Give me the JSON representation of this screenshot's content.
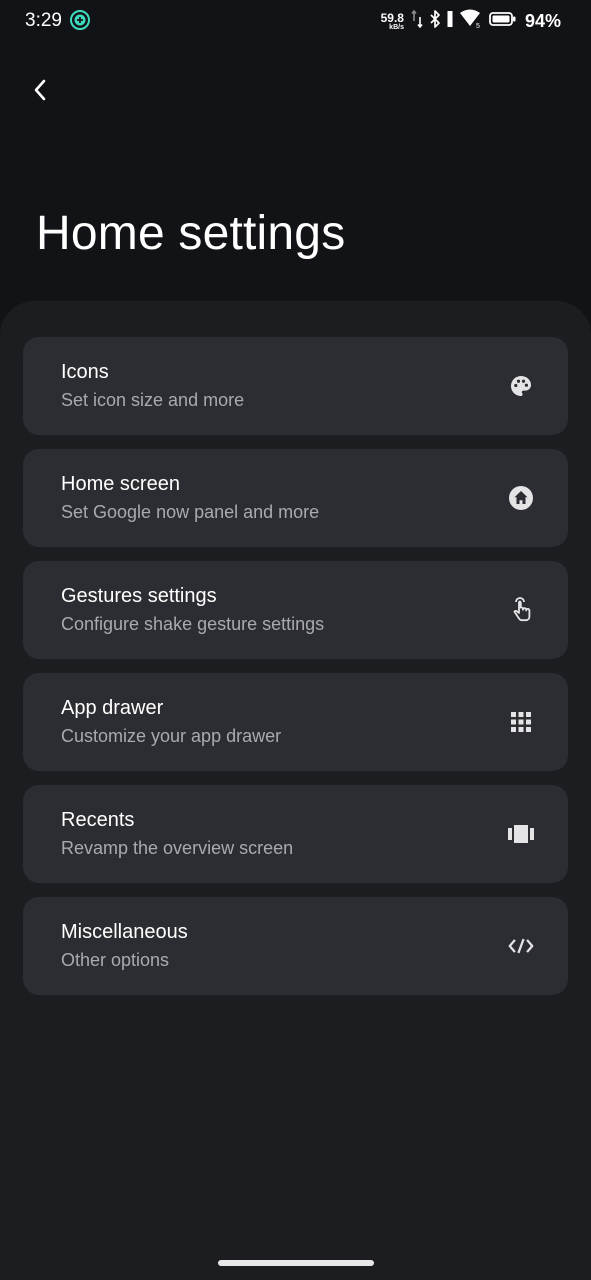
{
  "status_bar": {
    "time": "3:29",
    "net_speed_value": "59.8",
    "net_speed_unit": "kB/s",
    "battery_percent": "94%"
  },
  "header": {
    "title": "Home settings"
  },
  "settings": [
    {
      "title": "Icons",
      "subtitle": "Set icon size and more",
      "icon": "palette-icon"
    },
    {
      "title": "Home screen",
      "subtitle": "Set Google now panel and more",
      "icon": "home-icon"
    },
    {
      "title": "Gestures settings",
      "subtitle": "Configure shake gesture settings",
      "icon": "touch-gesture-icon"
    },
    {
      "title": "App drawer",
      "subtitle": "Customize your app drawer",
      "icon": "app-grid-icon"
    },
    {
      "title": "Recents",
      "subtitle": "Revamp the overview screen",
      "icon": "carousel-icon"
    },
    {
      "title": "Miscellaneous",
      "subtitle": "Other options",
      "icon": "code-icon"
    }
  ],
  "colors": {
    "background": "#121316",
    "sheet": "#1c1d21",
    "card": "#2c2d32",
    "subtitle": "#a9aab0",
    "status_app_icon": "#3ddbc0"
  }
}
